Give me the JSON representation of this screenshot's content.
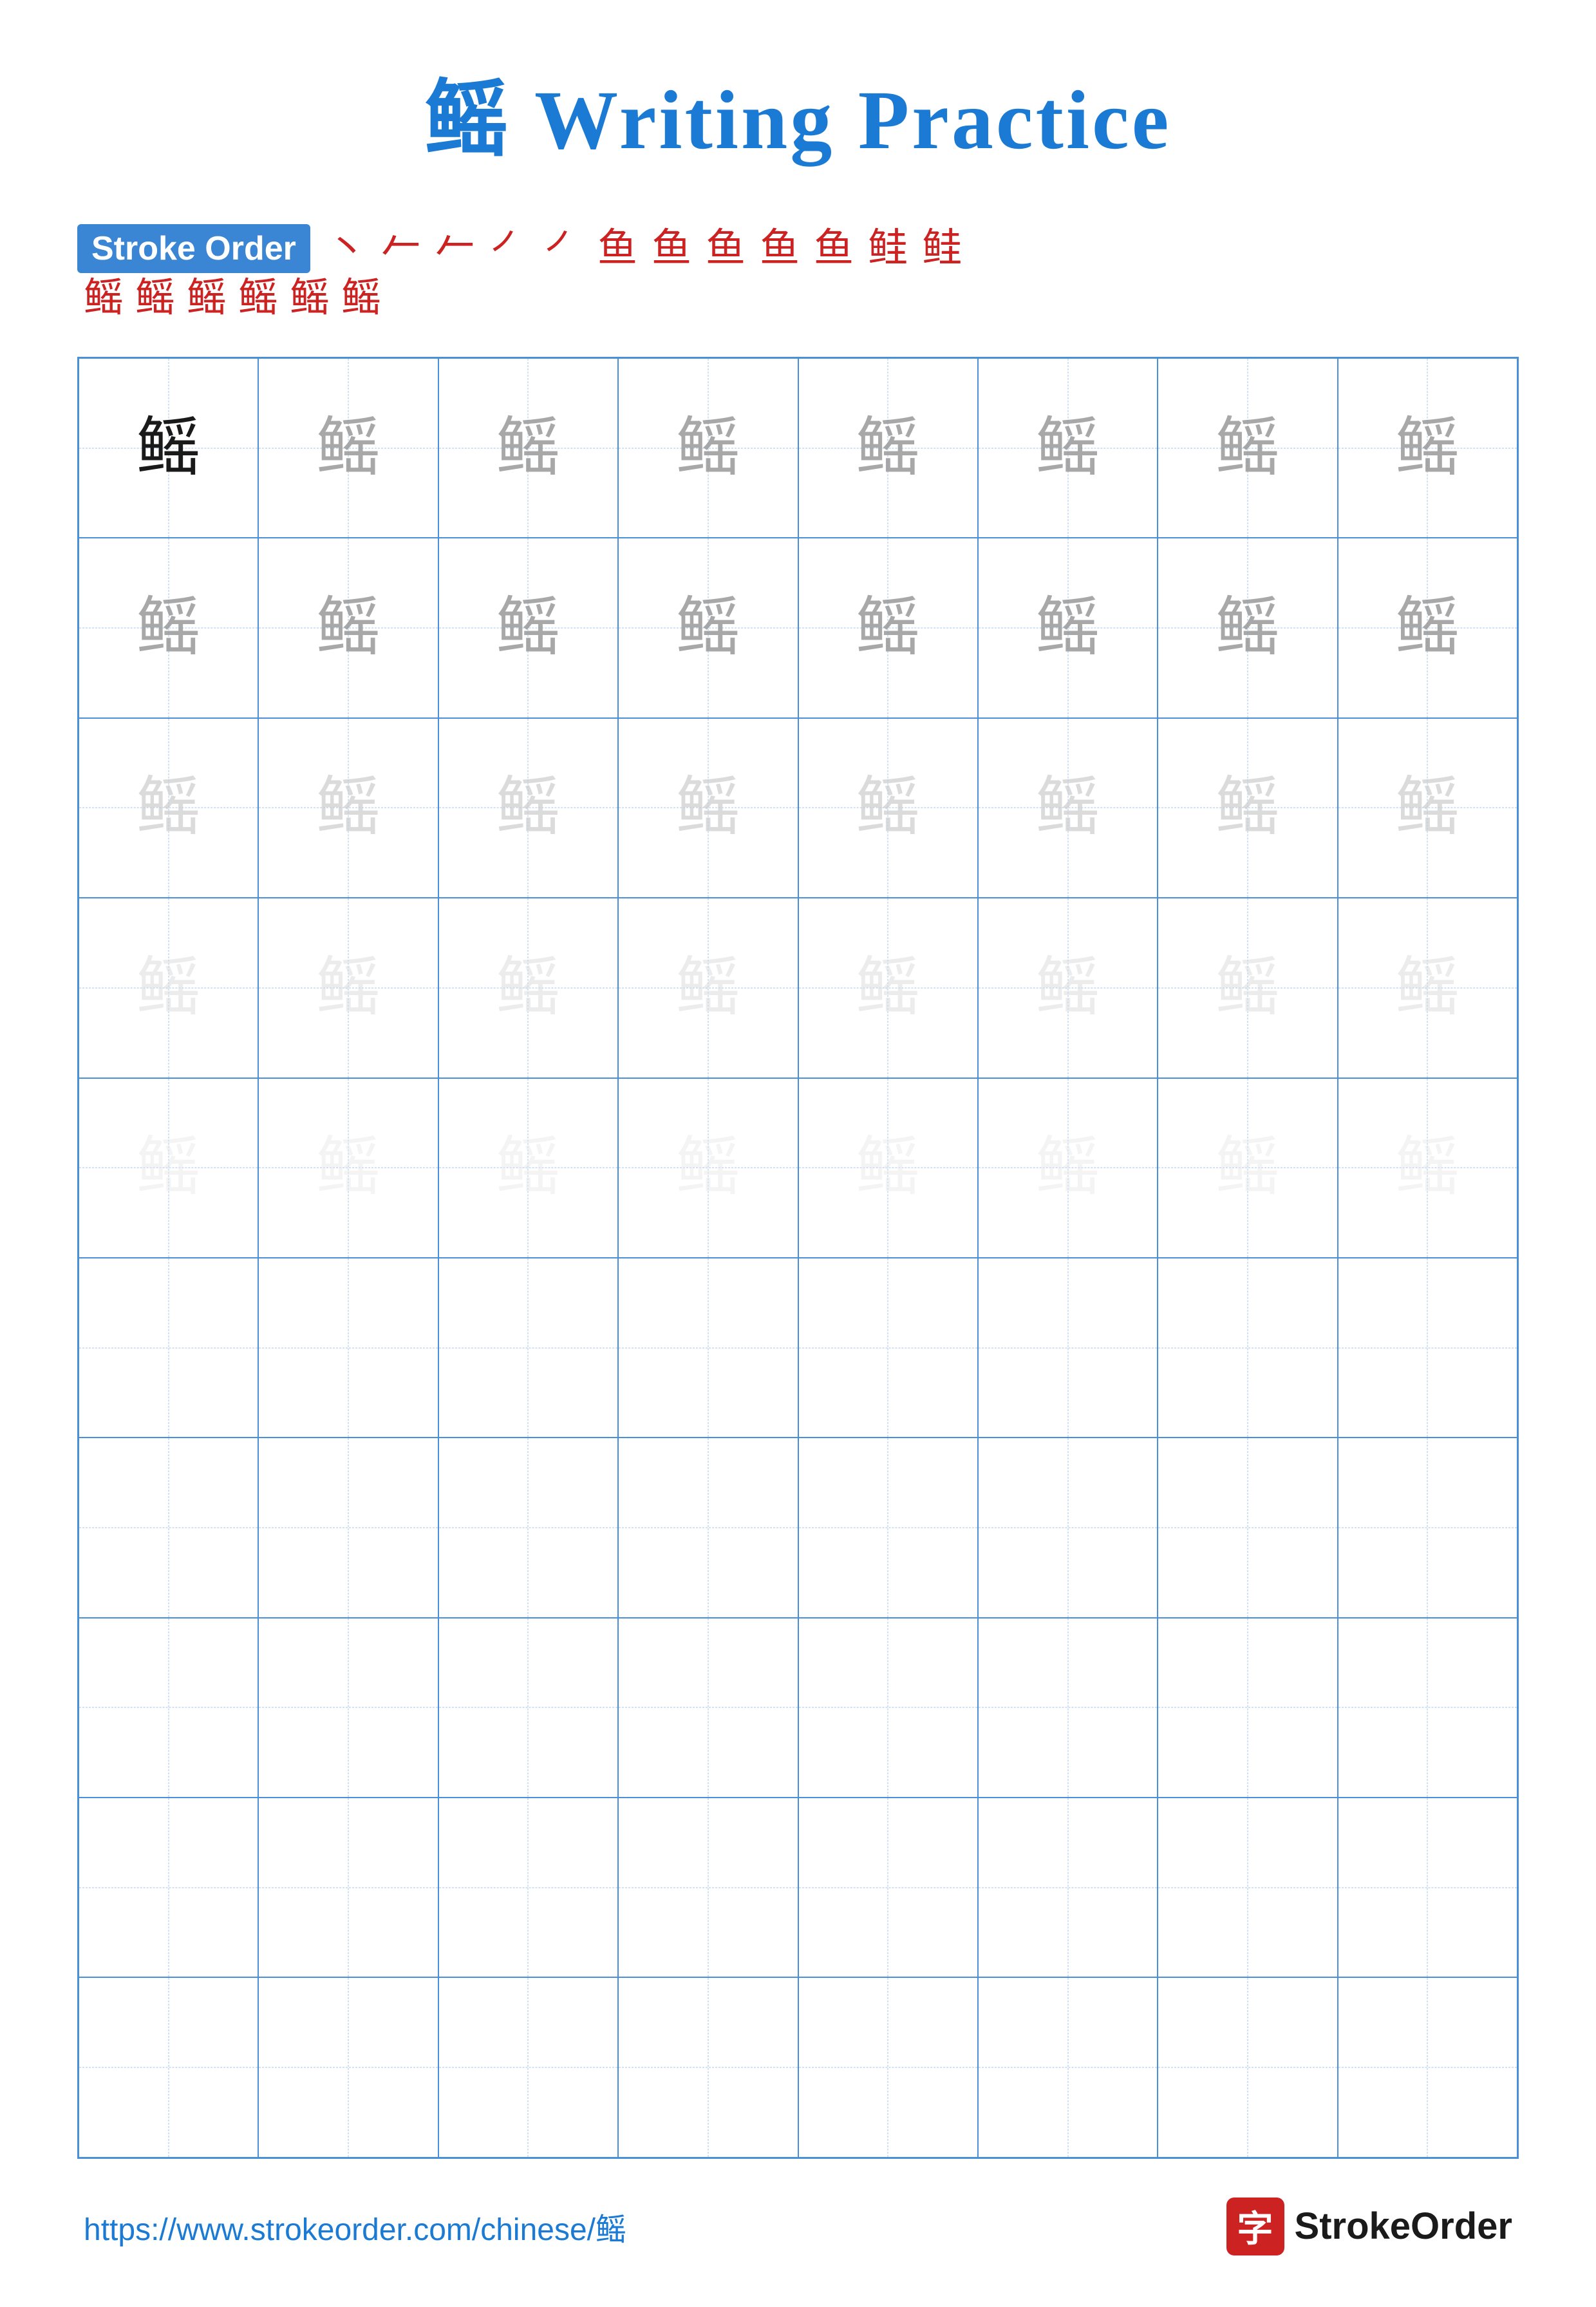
{
  "title": {
    "char": "鳐",
    "text": " Writing Practice",
    "full": "鳐 Writing Practice"
  },
  "stroke_order": {
    "label": "Stroke Order",
    "strokes_row1": [
      "丶",
      "ノ",
      "𠂉",
      "㇒",
      "㇒",
      "鱼",
      "鱼",
      "鱼",
      "鱼",
      "鱼",
      "鱼",
      "鱼"
    ],
    "strokes_row2": [
      "鱼",
      "鲑",
      "鲑",
      "鳐",
      "鳐",
      "鳐"
    ],
    "main_char": "鳐"
  },
  "grid": {
    "rows": 10,
    "cols": 8,
    "char": "鳐"
  },
  "footer": {
    "url": "https://www.strokeorder.com/chinese/鳐",
    "logo_char": "字",
    "logo_text": "StrokeOrder"
  }
}
